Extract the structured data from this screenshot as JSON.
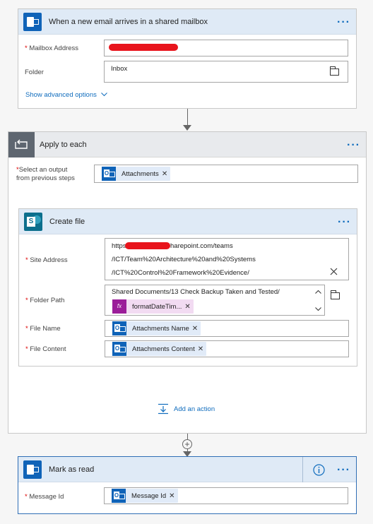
{
  "trigger": {
    "title": "When a new email arrives in a shared mailbox",
    "mailbox_label": "Mailbox Address",
    "mailbox_value": "",
    "folder_label": "Folder",
    "folder_value": "Inbox",
    "advanced_link": "Show advanced options",
    "menu": "···"
  },
  "apply": {
    "title": "Apply to each",
    "select_label_1": "Select an output",
    "select_label_2": "from previous steps",
    "token": "Attachments",
    "menu": "···"
  },
  "create_file": {
    "title": "Create file",
    "site_label": "Site Address",
    "site_line1_pre": "https",
    "site_line1_post": "harepoint.com/teams",
    "site_line2": "/ICT/Team%20Architecture%20and%20Systems",
    "site_line3": "/ICT%20Control%20Framework%20Evidence/",
    "folder_label": "Folder Path",
    "folder_text": "Shared Documents/13 Check Backup Taken and Tested/",
    "folder_token": "formatDateTim...",
    "filename_label": "File Name",
    "filename_token": "Attachments Name",
    "filecontent_label": "File Content",
    "filecontent_token": "Attachments Content",
    "menu": "···"
  },
  "add_action": "Add an action",
  "mark_read": {
    "title": "Mark as read",
    "msgid_label": "Message Id",
    "msgid_token": "Message Id",
    "menu": "···"
  },
  "colors": {
    "accent": "#0f6cbd",
    "header_bg": "#dfeaf6",
    "outlook_blue": "#0f63b8",
    "sharepoint_teal": "#0c6f8d",
    "expression_purple": "#9b1d99",
    "required": "#dd0000",
    "redaction": "#e8141c"
  },
  "icons": [
    "outlook-icon",
    "loop-icon",
    "sharepoint-icon",
    "folder-icon",
    "close-icon",
    "chevron-down-icon",
    "chevron-up-icon",
    "add-action-icon",
    "plus-circle-icon",
    "info-icon"
  ]
}
